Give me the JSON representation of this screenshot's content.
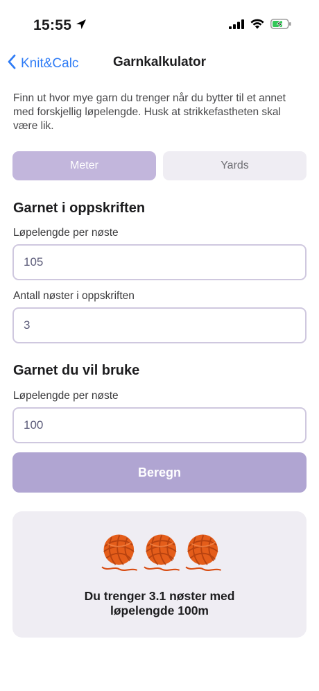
{
  "status_bar": {
    "time": "15:55",
    "icons": [
      "location-arrow-icon",
      "cellular-signal-icon",
      "wifi-icon",
      "battery-charging-icon"
    ]
  },
  "nav": {
    "back_label": "Knit&Calc",
    "title": "Garnkalkulator"
  },
  "intro": "Finn ut hvor mye garn du trenger når du bytter til et annet med forskjellig løpelengde. Husk at strikkefastheten skal være lik.",
  "unit_toggle": {
    "options": [
      "Meter",
      "Yards"
    ],
    "selected": "Meter"
  },
  "pattern_yarn": {
    "title": "Garnet i oppskriften",
    "length_label": "Løpelengde per nøste",
    "length_value": "105",
    "count_label": "Antall nøster i oppskriften",
    "count_value": "3"
  },
  "new_yarn": {
    "title": "Garnet du vil bruke",
    "length_label": "Løpelengde per nøste",
    "length_value": "100"
  },
  "calculate_label": "Beregn",
  "result": {
    "balls_icon": "yarn-ball-icon",
    "ball_count_shown": 3,
    "line1": "Du trenger 3.1 nøster med",
    "line2": "løpelengde 100m"
  },
  "colors": {
    "accent": "#2f7cf6",
    "toggle_active": "#c2b6dc",
    "button": "#b0a5d2",
    "yarn": "#e45d1a"
  }
}
